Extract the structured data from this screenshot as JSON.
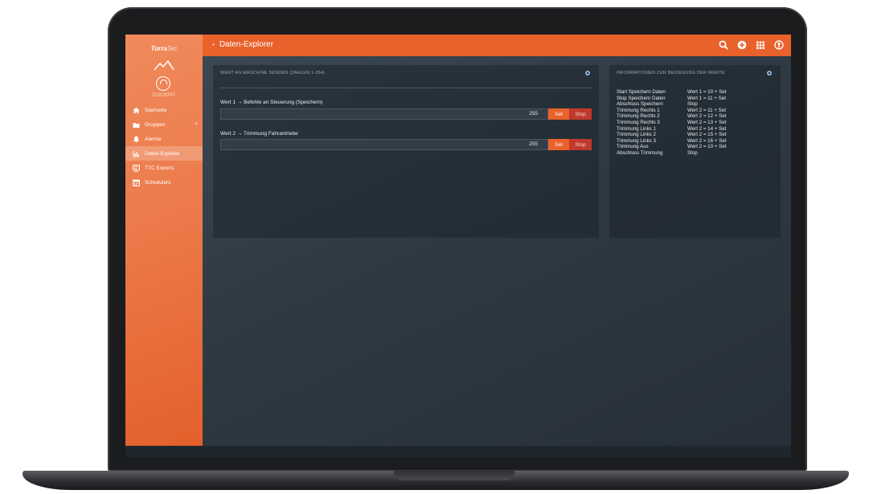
{
  "app": {
    "logo_text": "Torra",
    "logo_sub": "Tec",
    "cockpit_label": "COCKPIT",
    "page_title": "Daten-Explorer"
  },
  "sidebar": {
    "items": [
      {
        "label": "Startseite",
        "icon": "home-icon"
      },
      {
        "label": "Gruppen",
        "icon": "folder-icon",
        "chevron": "<"
      },
      {
        "label": "Alarme",
        "icon": "bell-icon"
      },
      {
        "label": "Daten-Explorer",
        "icon": "bar-chart-icon",
        "active": true
      },
      {
        "label": "TTC Exports",
        "icon": "export-icon"
      },
      {
        "label": "Schedulers",
        "icon": "calendar-icon"
      }
    ]
  },
  "topbar": {
    "icons": [
      "search-icon",
      "add-icon",
      "apps-grid-icon",
      "user-icon"
    ]
  },
  "main_panel": {
    "header": "WERT AN MASCHINE SENDEN (ZAHLEN 1-254)",
    "rows": [
      {
        "label": "Wert 1 → Befehle an Steuerung (Speichern)",
        "value": "255",
        "set_label": "Set",
        "stop_label": "Stop"
      },
      {
        "label": "Wert 2 → Trimmung Fahrantriebe",
        "value": "255",
        "set_label": "Set",
        "stop_label": "Stop"
      }
    ]
  },
  "info_panel": {
    "header": "INFORMATIONEN ZUR BEDIENUNG DER WERTE",
    "rows": [
      {
        "k": "Start Speichern Daten",
        "v": "Wert 1 = 10 + Set"
      },
      {
        "k": "Stop Speichern Daten",
        "v": "Wert 1 = 11 + Set"
      },
      {
        "k": "Abschluss Speichern",
        "v": "Stop"
      },
      {
        "k": "Trimmung Rechts 1",
        "v": "Wert 2 = 11 + Set"
      },
      {
        "k": "Trimmung Rechts 2",
        "v": "Wert 2 = 12 + Set"
      },
      {
        "k": "Trimmung Rechts 3",
        "v": "Wert 2 = 13 + Set"
      },
      {
        "k": "Trimmung Links 1",
        "v": "Wert 2 = 14 + Set"
      },
      {
        "k": "Trimmung Links 2",
        "v": "Wert 2 = 15 + Set"
      },
      {
        "k": "Trimmung Links 3",
        "v": "Wert 2 = 16 + Set"
      },
      {
        "k": "Trimmung Aus",
        "v": "Wert 2 = 10 + Set"
      },
      {
        "k": "Abschluss Trimmung",
        "v": "Stop"
      }
    ]
  },
  "colors": {
    "accent": "#e9612b",
    "stop": "#c0392b",
    "sidebar_top": "#f08a5c",
    "background": "#2c3640"
  }
}
